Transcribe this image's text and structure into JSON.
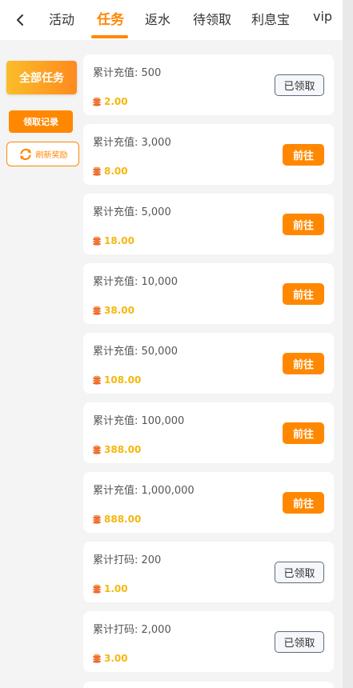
{
  "nav": {
    "back_icon": "chevron-left-icon",
    "tabs": [
      {
        "label": "活动",
        "active": false
      },
      {
        "label": "任务",
        "active": true
      },
      {
        "label": "返水",
        "active": false
      },
      {
        "label": "待领取",
        "active": false
      },
      {
        "label": "利息宝",
        "active": false
      },
      {
        "label": "vip",
        "active": false
      }
    ]
  },
  "sidebar": {
    "all_tasks_label": "全部任务",
    "claim_record_label": "领取记录",
    "refresh_label": "刷新奖励"
  },
  "tasks": [
    {
      "title": "累计充值: 500",
      "reward": "2.00",
      "button": "已领取",
      "status": "claimed"
    },
    {
      "title": "累计充值: 3,000",
      "reward": "8.00",
      "button": "前往",
      "status": "go"
    },
    {
      "title": "累计充值: 5,000",
      "reward": "18.00",
      "button": "前往",
      "status": "go"
    },
    {
      "title": "累计充值: 10,000",
      "reward": "38.00",
      "button": "前往",
      "status": "go"
    },
    {
      "title": "累计充值: 50,000",
      "reward": "108.00",
      "button": "前往",
      "status": "go"
    },
    {
      "title": "累计充值: 100,000",
      "reward": "388.00",
      "button": "前往",
      "status": "go"
    },
    {
      "title": "累计充值: 1,000,000",
      "reward": "888.00",
      "button": "前往",
      "status": "go"
    },
    {
      "title": "累计打码: 200",
      "reward": "1.00",
      "button": "已领取",
      "status": "claimed"
    },
    {
      "title": "累计打码: 2,000",
      "reward": "3.00",
      "button": "已领取",
      "status": "claimed"
    },
    {
      "title": "",
      "reward": "",
      "button": "",
      "status": "partial"
    }
  ],
  "colors": {
    "accent": "#ff8800",
    "reward_text": "#f5b70e",
    "coin": "#ef6a2d"
  }
}
